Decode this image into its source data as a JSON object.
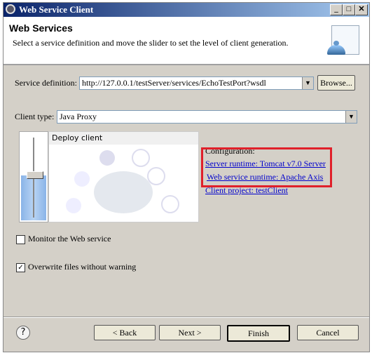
{
  "window": {
    "title": "Web Service Client",
    "controls": [
      "_",
      "□",
      "✕"
    ]
  },
  "header": {
    "title": "Web Services",
    "description": "Select a service definition and move the slider to set the level of client generation."
  },
  "service_definition": {
    "label": "Service definition:",
    "value": "http://127.0.0.1/testServer/services/EchoTestPort?wsdl",
    "browse": "Browse..."
  },
  "client_type": {
    "label": "Client type:",
    "value": "Java Proxy"
  },
  "slider": {
    "level": "Deploy client",
    "position_fraction": 0.5
  },
  "preview": {
    "title": "Deploy client"
  },
  "configuration": {
    "label": "Configuration:",
    "server_runtime": "Server runtime: Tomcat v7.0 Server",
    "ws_runtime": "Web service runtime: Apache Axis",
    "client_project": "Client project: testClient",
    "highlight_color": "#e0202a"
  },
  "monitor": {
    "label": "Monitor the Web service",
    "checked": false
  },
  "overwrite": {
    "label": "Overwrite files without warning",
    "checked": true,
    "mark": "✓"
  },
  "buttons": {
    "help": "?",
    "back": "< Back",
    "next": "Next >",
    "finish": "Finish",
    "cancel": "Cancel"
  }
}
